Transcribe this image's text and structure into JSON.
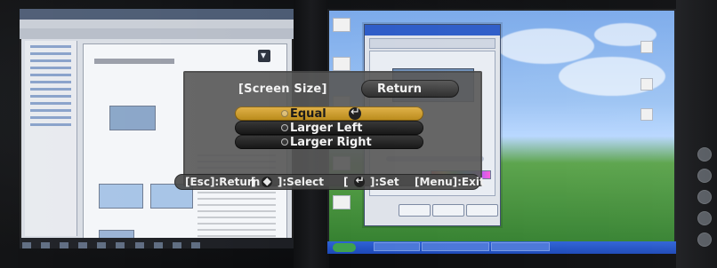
{
  "osd": {
    "title": "[Screen Size]",
    "return_label": "Return",
    "options": [
      "Equal",
      "Larger Left",
      "Larger Right"
    ],
    "selected_index": 0,
    "help": {
      "esc": "[Esc]:Return",
      "select_key": "[",
      "select_suffix": "]:Select",
      "set_key": "[",
      "set_suffix": "]:Set",
      "menu": "[Menu]:Exit"
    }
  },
  "icons": {
    "enter": "enter-icon",
    "nav": "navigation-pad-icon"
  },
  "colors": {
    "osd_background": "#585858",
    "highlight": "#d1a231"
  }
}
